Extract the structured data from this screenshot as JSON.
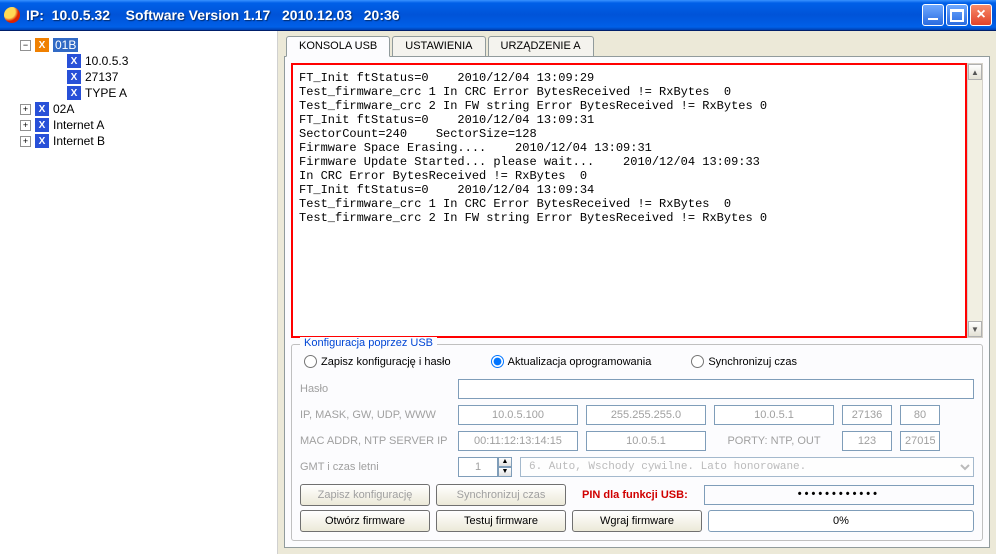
{
  "window": {
    "title": "IP:  10.0.5.32    Software Version 1.17   2010.12.03   20:36"
  },
  "tree": {
    "root": {
      "label": "01B",
      "expander": "−"
    },
    "children": [
      {
        "label": "10.0.5.3"
      },
      {
        "label": "27137"
      },
      {
        "label": "TYPE A"
      }
    ],
    "siblings": [
      {
        "label": "02A",
        "expander": "+"
      },
      {
        "label": "Internet A",
        "expander": "+"
      },
      {
        "label": "Internet B",
        "expander": "+"
      }
    ]
  },
  "tabs": {
    "t0": "KONSOLA USB",
    "t1": "USTAWIENIA",
    "t2": "URZĄDZENIE A"
  },
  "console_text": "FT_Init ftStatus=0    2010/12/04 13:09:29\nTest_firmware_crc 1 In CRC Error BytesReceived != RxBytes  0\nTest_firmware_crc 2 In FW string Error BytesReceived != RxBytes 0\nFT_Init ftStatus=0    2010/12/04 13:09:31\nSectorCount=240    SectorSize=128\nFirmware Space Erasing....    2010/12/04 13:09:31\nFirmware Update Started... please wait...    2010/12/04 13:09:33\nIn CRC Error BytesReceived != RxBytes  0\nFT_Init ftStatus=0    2010/12/04 13:09:34\nTest_firmware_crc 1 In CRC Error BytesReceived != RxBytes  0\nTest_firmware_crc 2 In FW string Error BytesReceived != RxBytes 0",
  "group": {
    "legend": "Konfiguracja poprzez USB",
    "radio_save": "Zapisz konfigurację i hasło",
    "radio_update": "Aktualizacja oprogramowania",
    "radio_sync": "Synchronizuj czas",
    "lbl_pass": "Hasło",
    "lbl_ip": "IP, MASK, GW, UDP, WWW",
    "lbl_mac": "MAC ADDR, NTP SERVER IP",
    "lbl_gmt": "GMT i czas letni",
    "ip_val": "10.0.5.100",
    "mask_val": "255.255.255.0",
    "gw_val": "10.0.5.1",
    "udp_val": "27136",
    "www_val": "80",
    "mac_val": "00:11:12:13:14:15",
    "ntp_val": "10.0.5.1",
    "ports_lbl": "PORTY: NTP, OUT",
    "ntp_port": "123",
    "out_port": "27015",
    "gmt_val": "1",
    "combo_val": "6. Auto, Wschody cywilne. Lato honorowane.",
    "btn_savecfg": "Zapisz konfigurację",
    "btn_synctime": "Synchronizuj czas",
    "pin_label": "PIN dla funkcji USB:",
    "pin_value": "••••••••••••",
    "btn_open": "Otwórz firmware",
    "btn_test": "Testuj firmware",
    "btn_upload": "Wgraj firmware",
    "progress": "0%"
  }
}
